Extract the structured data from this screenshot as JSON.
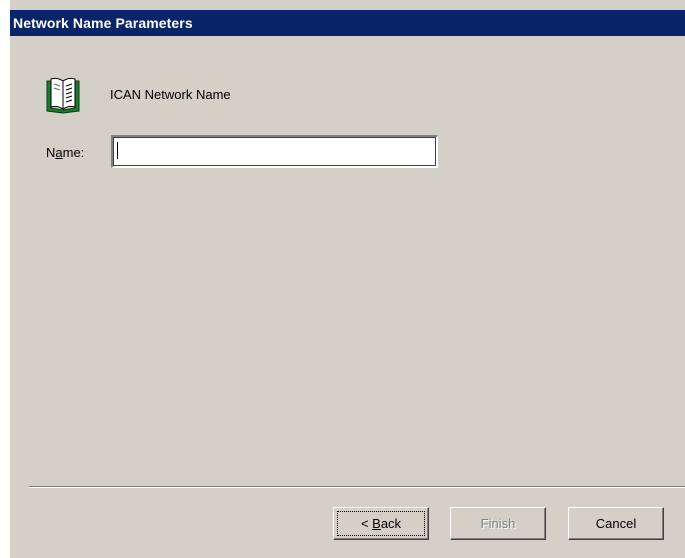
{
  "window": {
    "title": "Network Name Parameters"
  },
  "content": {
    "icon": "open-book-icon",
    "heading": "ICAN Network Name",
    "name_label_prefix": "N",
    "name_label_accel": "a",
    "name_label_suffix": "me:",
    "name_value": ""
  },
  "buttons": {
    "back_prefix": "< ",
    "back_accel": "B",
    "back_suffix": "ack",
    "finish": "Finish",
    "cancel": "Cancel"
  },
  "colors": {
    "titlebar": "#0a246a",
    "face": "#d4d0c8",
    "disabled_text": "#808080"
  }
}
